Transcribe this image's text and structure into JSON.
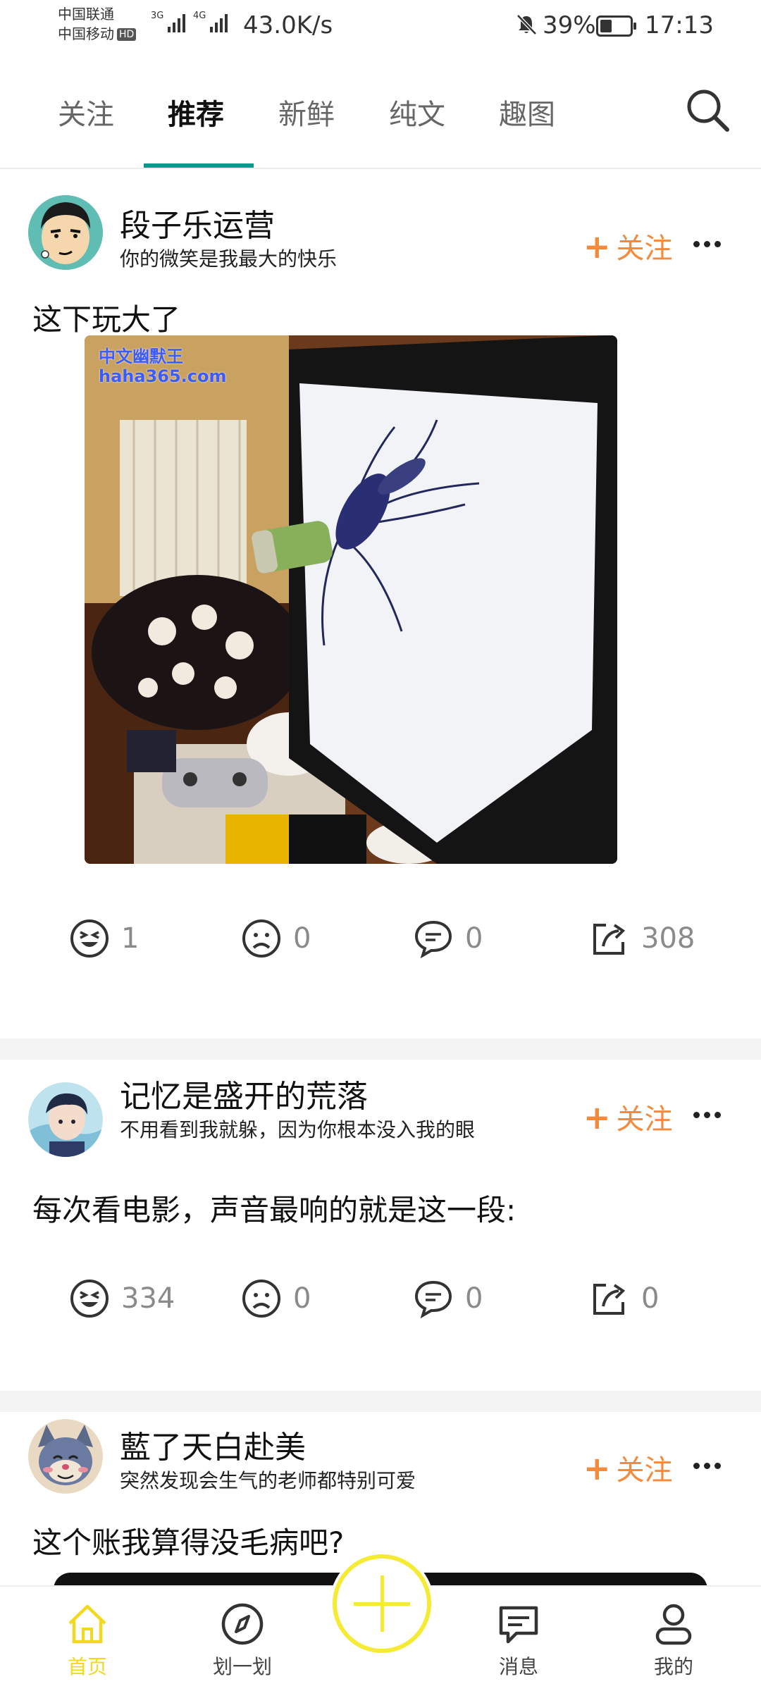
{
  "status_bar": {
    "carrier_1": "中国联通",
    "carrier_2": "中国移动",
    "hd_badge": "HD",
    "network_1": "3G",
    "network_2": "4G",
    "speed": "43.0K/s",
    "battery": "39%",
    "battery_level": 0.39,
    "time": "17:13"
  },
  "tabs": [
    "关注",
    "推荐",
    "新鲜",
    "纯文",
    "趣图"
  ],
  "active_tab": "推荐",
  "posts": [
    {
      "username": "段子乐运营",
      "signature": "你的微笑是我最大的快乐",
      "follow_label": "关注",
      "text": "这下玩大了",
      "watermark_1": "中文幽默王",
      "watermark_2": "haha365.com",
      "likes": "1",
      "dislikes": "0",
      "comments": "0",
      "shares": "308"
    },
    {
      "username": "记忆是盛开的荒落",
      "signature": "不用看到我就躲，因为你根本没入我的眼",
      "follow_label": "关注",
      "text": "每次看电影，声音最响的就是这一段:",
      "likes": "334",
      "dislikes": "0",
      "comments": "0",
      "shares": "0"
    },
    {
      "username": "藍了天白赴美",
      "signature": "突然发现会生气的老师都特别可爱",
      "follow_label": "关注",
      "text": "这个账我算得没毛病吧?"
    }
  ],
  "bottom_nav": {
    "home": "首页",
    "explore": "划一划",
    "messages": "消息",
    "profile": "我的"
  },
  "colors": {
    "accent_teal": "#10968b",
    "follow_orange": "#f48a3c",
    "nav_active_yellow": "#f3d820"
  }
}
